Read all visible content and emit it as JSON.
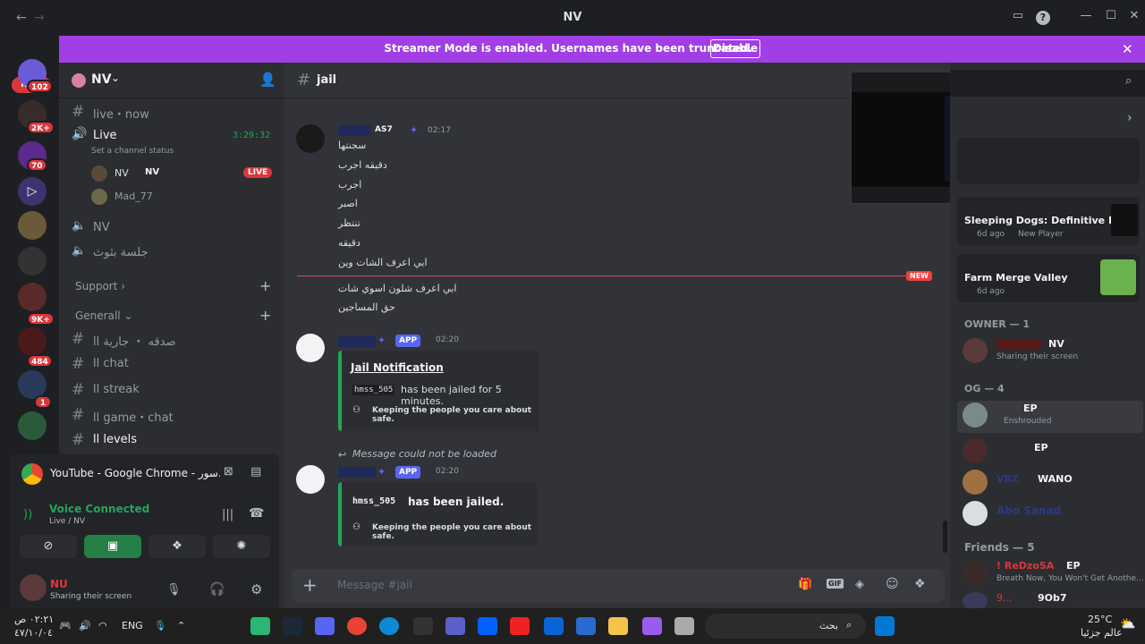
{
  "window": {
    "title": "NV"
  },
  "banner": {
    "text": "Streamer Mode is enabled. Usernames have been truncated.",
    "button": "Disable"
  },
  "rail": {
    "new_pill": "NEW",
    "badges": [
      "102",
      "2K+",
      "70",
      "9K+",
      "484",
      "1"
    ]
  },
  "server": {
    "name": "NV"
  },
  "channels": {
    "live_now": "live・now",
    "live_voice": "Live",
    "live_timer": "3:29:32",
    "channel_status": "Set a channel status",
    "live_user1": "NV",
    "live_user1_tag": "NV",
    "live_badge": "LIVE",
    "live_user2": "Mad_77",
    "nv_voice": "NV",
    "session_voice": "جلسة بثوث",
    "support_cat": "Support",
    "general_cat": "Generall",
    "ch_sadaqa": "صدقه ・ جارية اا",
    "ch_chat": "اا chat",
    "ch_streak": "اا streak",
    "ch_game": "اا game・chat",
    "ch_levels": "اا levels"
  },
  "stream_card": {
    "title": "YouTube - Google Chrome - سور..."
  },
  "voice": {
    "status": "Voice Connected",
    "sub": "Live / NV"
  },
  "user": {
    "name": "NU",
    "status": "Sharing their screen"
  },
  "chat": {
    "channel": "jail",
    "msg1": {
      "tag": "AS7",
      "time": "02:17",
      "lines": [
        "سجنتها",
        "دقيقه اجرب",
        "اجرب",
        "اصبر",
        "تنتظر",
        "دقيقه",
        "ابي اعرف الشات وين"
      ]
    },
    "new_divider": "NEW",
    "msg1b": {
      "lines": [
        "ابي اعرف شلون اسوي شات",
        "حق المساجين"
      ]
    },
    "msg2": {
      "app": "APP",
      "time": "02:20",
      "embed_title": "Jail Notification",
      "embed_user": "hmss_505",
      "embed_text": "has been jailed for 5 minutes.",
      "footer": "Keeping the people you care about safe."
    },
    "reply_note": "Message could not be loaded",
    "msg3": {
      "app": "APP",
      "time": "02:20",
      "embed_user": "hmss_505",
      "embed_text": "has been jailed.",
      "footer": "Keeping the people you care about safe."
    },
    "composer_placeholder": "Message #jail"
  },
  "members": {
    "activity1_title": "Sleeping Dogs: Definitive E...",
    "activity1_time": "6d ago",
    "activity1_tag": "New Player",
    "activity2_title": "Farm Merge Valley",
    "activity2_time": "6d ago",
    "owner_header": "OWNER — 1",
    "owner_tag": "NV",
    "owner_status": "Sharing their screen",
    "og_header": "OG — 4",
    "og1_tag": "EP",
    "og1_status": "Enshrouded",
    "og2_tag": "EP",
    "og3_name": "VRZ",
    "og3_tag": "WANO",
    "og4_name": "Abo Sanad",
    "friends_header": "Friends — 5",
    "fr1_name": "! ReDzoSA",
    "fr1_tag": "EP",
    "fr1_status": "Breath Now, You Won't Get Anothe...",
    "fr2_name": "9...",
    "fr2_tag": "9Ob7"
  },
  "taskbar": {
    "time": "٠٢:٢١ ص",
    "date": "٤٧/١٠/٠٤",
    "lang": "ENG",
    "search": "بحث",
    "temp": "25°C",
    "weather": "عالم جزئيا"
  }
}
